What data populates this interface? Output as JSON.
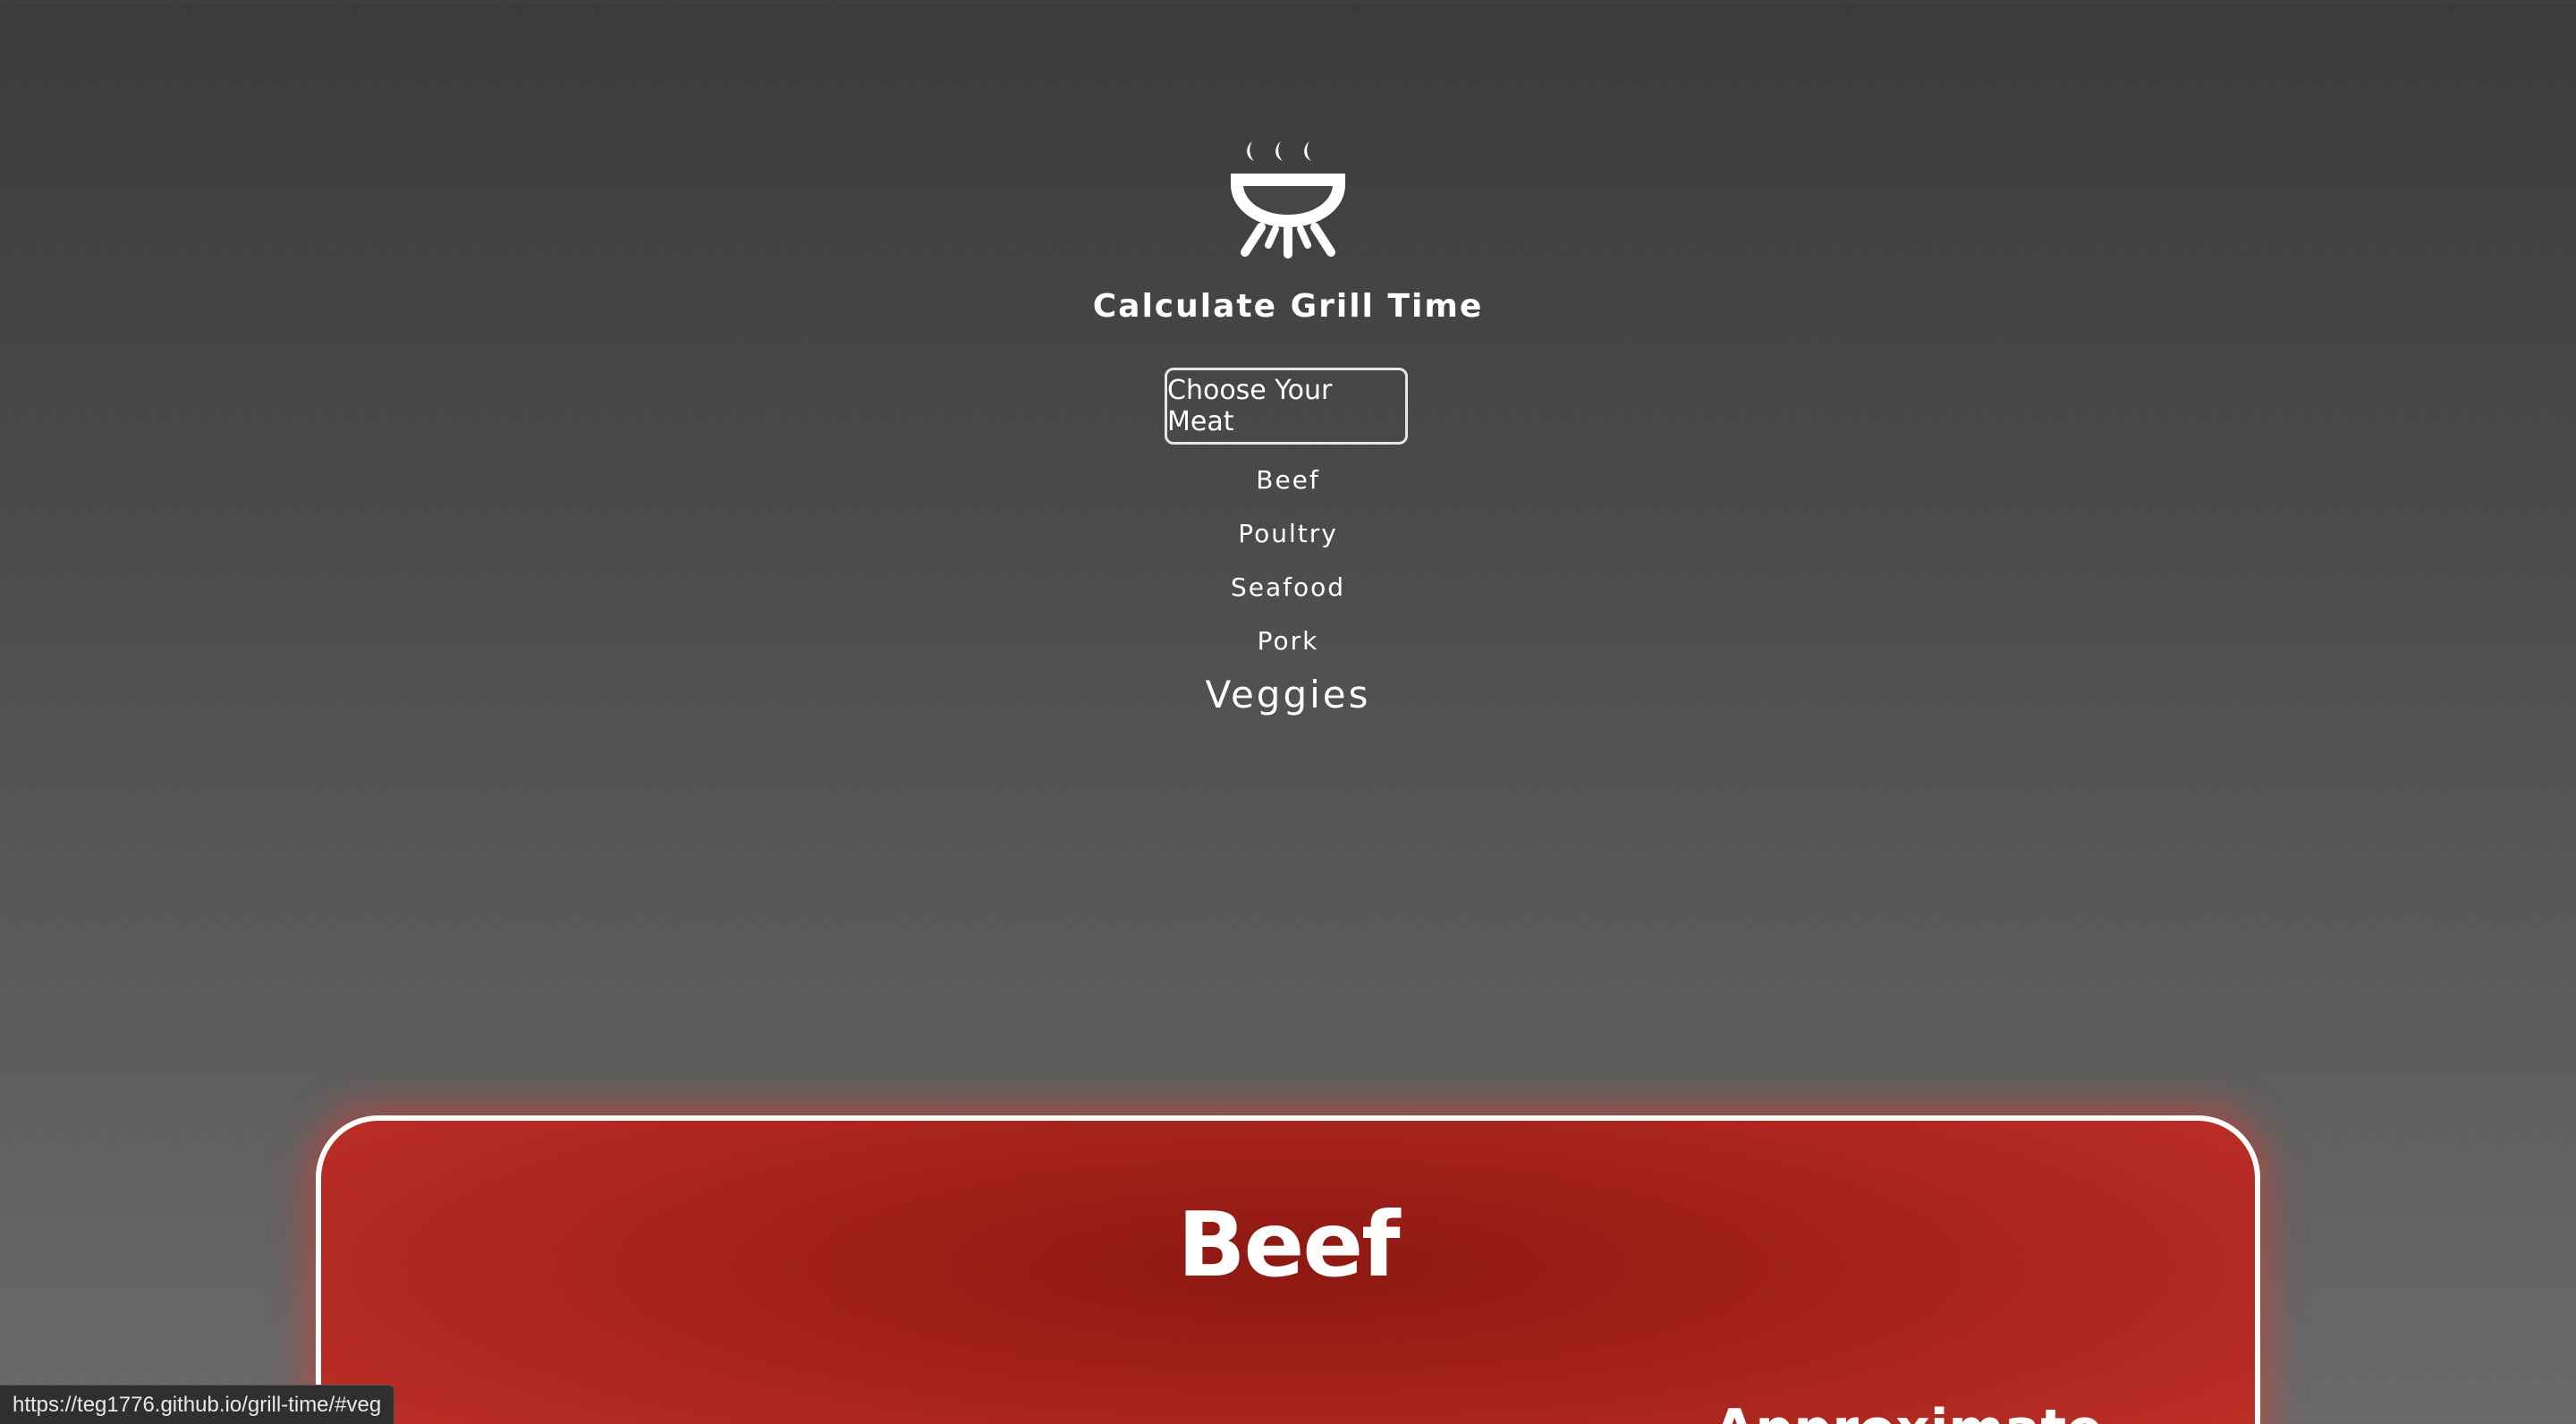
{
  "header": {
    "title": "Calculate Grill Time",
    "choose_button_label": "Choose Your Meat",
    "logo_icon": "grill-icon"
  },
  "menu": {
    "items": [
      {
        "label": "Beef"
      },
      {
        "label": "Poultry"
      },
      {
        "label": "Seafood"
      },
      {
        "label": "Pork"
      },
      {
        "label": "Veggies"
      }
    ]
  },
  "card": {
    "title": "Beef",
    "partial_left_text": "",
    "partial_right_text": "Approximate"
  },
  "status_bar": {
    "url": "https://teg1776.github.io/grill-time/#veg"
  },
  "colors": {
    "background_top": "#3b3b3b",
    "background_bottom": "#6a6a6a",
    "card_red": "#a5231b",
    "text": "#ffffff"
  }
}
